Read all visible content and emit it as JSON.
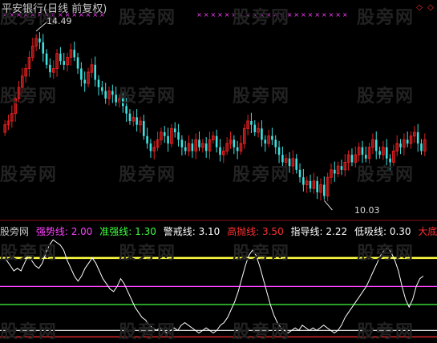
{
  "header": {
    "title": "平安银行(日线 前复权)"
  },
  "watermark": "股旁网",
  "colors": {
    "background": "#000000",
    "up_candle": "#e02020",
    "down_candle": "#40e0e0",
    "signal_marker": "#ff40ff",
    "indicator_line": "#ffffff",
    "strong": "#ff40ff",
    "quasi_strong": "#40ff40",
    "warning": "#ffffff",
    "high_sell": "#ff3030",
    "guide": "#ffffff",
    "low_buy": "#ffffff",
    "bottom_zone": "#ff3030",
    "yellow_line": "#ffff40"
  },
  "indicator": {
    "source_label": "股旁网",
    "strong_label": "强势线:",
    "strong_value": "2.00",
    "quasi_label": "准强线:",
    "quasi_value": "1.30",
    "warn_label": "警戒线:",
    "warn_value": "3.10",
    "high_label": "高抛线:",
    "high_value": "3.50",
    "guide_label": "指导线:",
    "guide_value": "2.22",
    "low_label": "低吸线:",
    "low_value": "0.30",
    "bottom_label": "大底区域"
  },
  "chart_data": [
    {
      "type": "candlestick",
      "title": "平安银行(日线 前复权)",
      "annotations": [
        {
          "text": "14.49",
          "kind": "high"
        },
        {
          "text": "10.03",
          "kind": "low"
        }
      ],
      "ylim": [
        9.6,
        14.9
      ],
      "closes": [
        12.0,
        12.1,
        12.3,
        12.7,
        13.0,
        13.3,
        13.5,
        13.8,
        14.1,
        14.3,
        14.2,
        13.9,
        13.6,
        13.4,
        13.5,
        13.9,
        13.7,
        13.6,
        13.8,
        14.0,
        13.8,
        13.5,
        13.2,
        13.1,
        13.4,
        13.6,
        13.2,
        13.0,
        12.9,
        12.7,
        12.9,
        12.8,
        12.6,
        12.7,
        12.5,
        12.3,
        12.1,
        12.2,
        12.0,
        12.1,
        11.7,
        11.5,
        11.3,
        11.4,
        11.6,
        11.8,
        11.7,
        11.5,
        11.9,
        11.8,
        11.6,
        11.4,
        11.3,
        11.5,
        11.3,
        11.6,
        11.4,
        11.5,
        11.3,
        11.6,
        11.7,
        11.4,
        11.2,
        11.3,
        11.5,
        11.6,
        11.4,
        11.3,
        11.5,
        11.9,
        12.1,
        12.0,
        11.8,
        11.9,
        11.6,
        11.5,
        11.7,
        11.6,
        11.4,
        11.2,
        11.0,
        11.1,
        10.9,
        11.1,
        10.8,
        10.6,
        10.4,
        10.5,
        10.3,
        10.5,
        10.2,
        10.4,
        10.1,
        10.6,
        10.8,
        10.7,
        10.9,
        10.8,
        11.0,
        11.2,
        11.0,
        11.2,
        11.4,
        11.2,
        11.1,
        11.4,
        11.6,
        11.3,
        11.2,
        11.4,
        11.1,
        11.0,
        11.3,
        11.5,
        11.4,
        11.6,
        11.5,
        11.7,
        11.8,
        11.5,
        11.3,
        11.6
      ],
      "signal_marks_top": true
    },
    {
      "type": "line",
      "title": "",
      "series": [
        {
          "name": "",
          "values": [
            3.1,
            3.0,
            2.8,
            2.6,
            2.7,
            2.6,
            2.9,
            3.2,
            3.0,
            2.8,
            2.7,
            2.9,
            3.3,
            3.6,
            3.8,
            3.7,
            3.6,
            3.4,
            3.0,
            2.7,
            2.4,
            2.2,
            2.4,
            2.7,
            2.9,
            3.1,
            2.9,
            2.6,
            2.3,
            2.1,
            1.9,
            1.8,
            2.0,
            2.3,
            2.1,
            1.8,
            1.5,
            1.2,
            1.0,
            0.8,
            0.7,
            0.5,
            0.4,
            0.3,
            0.4,
            0.3,
            0.2,
            0.3,
            0.4,
            0.3,
            0.5,
            0.6,
            0.5,
            0.4,
            0.3,
            0.2,
            0.3,
            0.4,
            0.3,
            0.2,
            0.3,
            0.5,
            0.6,
            0.8,
            1.1,
            1.4,
            1.8,
            2.3,
            2.8,
            3.2,
            3.4,
            3.2,
            2.8,
            2.3,
            1.8,
            1.3,
            0.9,
            0.6,
            0.4,
            0.3,
            0.2,
            0.3,
            0.4,
            0.3,
            0.5,
            0.4,
            0.3,
            0.4,
            0.3,
            0.4,
            0.5,
            0.4,
            0.3,
            0.2,
            0.3,
            0.5,
            0.8,
            1.0,
            1.2,
            1.4,
            1.6,
            1.8,
            2.0,
            2.3,
            2.6,
            2.9,
            3.2,
            3.4,
            3.5,
            3.3,
            3.0,
            2.6,
            2.0,
            1.5,
            1.2,
            1.5,
            2.0,
            2.3,
            2.4
          ],
          "color": "#ffffff"
        }
      ],
      "reference_lines": [
        {
          "name": "警戒线",
          "value": 3.1,
          "color": "#ffff40"
        },
        {
          "name": "强势线",
          "value": 2.0,
          "color": "#ff40ff"
        },
        {
          "name": "准强线",
          "value": 1.3,
          "color": "#40ff40"
        },
        {
          "name": "低吸线",
          "value": 0.3,
          "color": "#ffffff"
        },
        {
          "name": "大底区域",
          "value": 0.05,
          "color": "#ff3030"
        }
      ],
      "ylim": [
        0,
        3.9
      ]
    }
  ]
}
